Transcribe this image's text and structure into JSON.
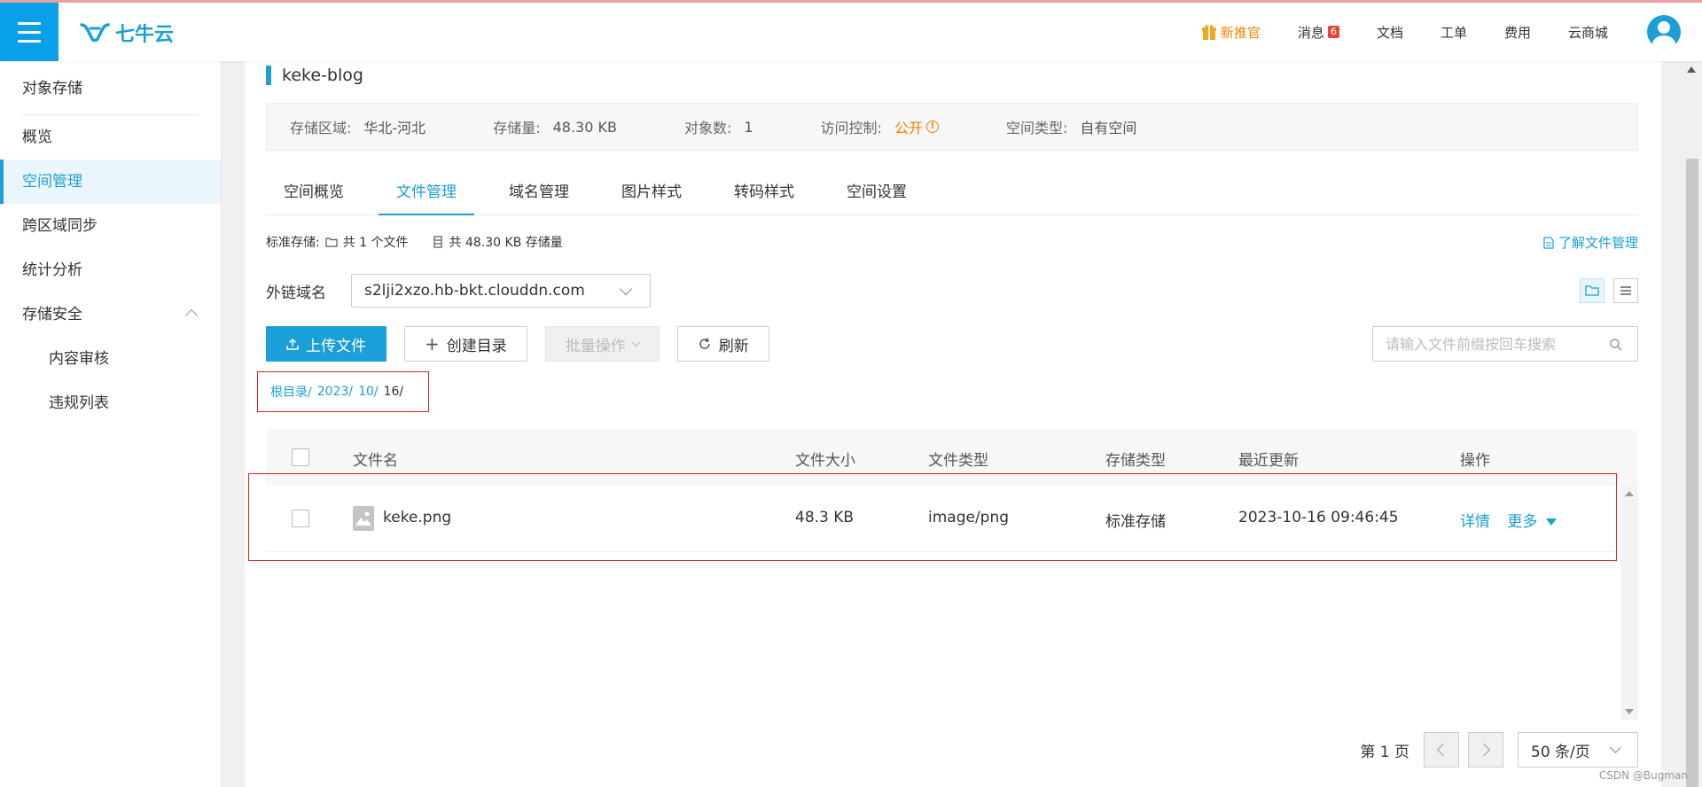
{
  "header": {
    "logo_text": "七牛云",
    "nav": [
      {
        "label": "新推官",
        "icon": "gift-icon"
      },
      {
        "label": "消息",
        "badge": "6"
      },
      {
        "label": "文档"
      },
      {
        "label": "工单"
      },
      {
        "label": "费用"
      },
      {
        "label": "云商城"
      }
    ]
  },
  "sidebar": {
    "title": "对象存储",
    "items": [
      {
        "label": "概览"
      },
      {
        "label": "空间管理",
        "active": true
      },
      {
        "label": "跨区域同步"
      },
      {
        "label": "统计分析"
      },
      {
        "label": "存储安全",
        "expanded": true
      }
    ],
    "sub_items": [
      {
        "label": "内容审核"
      },
      {
        "label": "违规列表"
      }
    ]
  },
  "bucket": {
    "name": "keke-blog",
    "info": [
      {
        "key": "存储区域:",
        "value": "华北-河北"
      },
      {
        "key": "存储量:",
        "value": "48.30 KB"
      },
      {
        "key": "对象数:",
        "value": "1"
      },
      {
        "key": "访问控制:",
        "value": "公开"
      },
      {
        "key": "空间类型:",
        "value": "自有空间"
      }
    ]
  },
  "tabs": [
    {
      "label": "空间概览"
    },
    {
      "label": "文件管理",
      "active": true
    },
    {
      "label": "域名管理"
    },
    {
      "label": "图片样式"
    },
    {
      "label": "转码样式"
    },
    {
      "label": "空间设置"
    }
  ],
  "stats": {
    "prefix": "标准存储:",
    "files": "共 1 个文件",
    "size": "共 48.30 KB 存储量"
  },
  "learn_link": "了解文件管理",
  "domain": {
    "label": "外链域名",
    "value": "s2lji2xzo.hb-bkt.clouddn.com"
  },
  "toolbar": {
    "upload": "上传文件",
    "mkdir": "创建目录",
    "batch": "批量操作",
    "refresh": "刷新",
    "search_placeholder": "请输入文件前缀按回车搜索"
  },
  "breadcrumb": [
    {
      "label": "根目录/"
    },
    {
      "label": "2023/"
    },
    {
      "label": "10/"
    },
    {
      "label": "16/",
      "current": true
    }
  ],
  "table": {
    "columns": [
      "文件名",
      "文件大小",
      "文件类型",
      "存储类型",
      "最近更新",
      "操作"
    ],
    "rows": [
      {
        "name": "keke.png",
        "size": "48.3 KB",
        "type": "image/png",
        "storage": "标准存储",
        "updated": "2023-10-16 09:46:45",
        "op_detail": "详情",
        "op_more": "更多"
      }
    ]
  },
  "pager": {
    "page_label": "第 1 页",
    "page_size": "50 条/页"
  },
  "watermark": "CSDN @Bugman"
}
